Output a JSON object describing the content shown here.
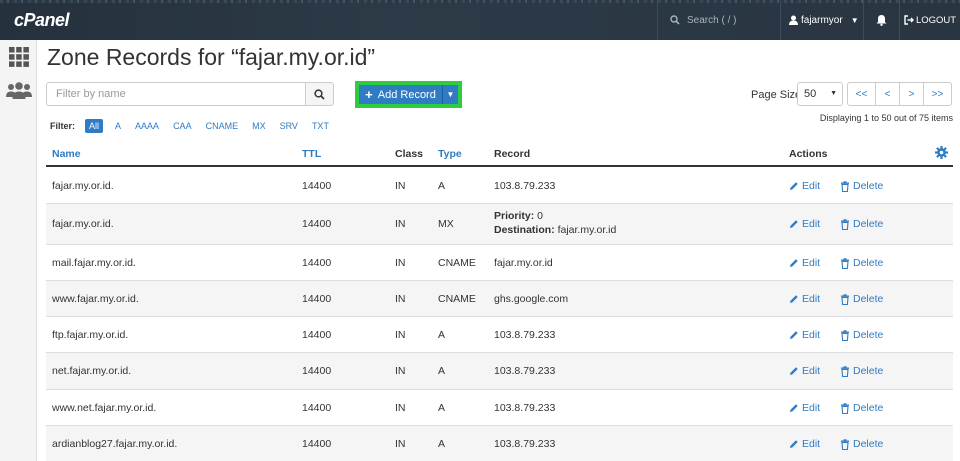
{
  "header": {
    "logo": "cPanel",
    "search_placeholder": "Search ( / )",
    "username": "fajarmyor",
    "logout": "LOGOUT"
  },
  "page": {
    "title": "Zone Records for “fajar.my.or.id”",
    "filter_placeholder": "Filter by name",
    "add_record": "Add Record",
    "page_size_label": "Page Size",
    "page_size_value": "50",
    "pager": [
      "<<",
      "<",
      ">",
      ">>"
    ],
    "displaying": "Displaying 1 to 50 out of 75 items",
    "filter_label": "Filter:",
    "filter_types": [
      "All",
      "A",
      "AAAA",
      "CAA",
      "CNAME",
      "MX",
      "SRV",
      "TXT"
    ]
  },
  "table": {
    "columns": {
      "name": "Name",
      "ttl": "TTL",
      "class": "Class",
      "type": "Type",
      "record": "Record",
      "actions": "Actions"
    },
    "edit_label": "Edit",
    "delete_label": "Delete",
    "rows": [
      {
        "name": "fajar.my.or.id.",
        "ttl": "14400",
        "class": "IN",
        "type": "A",
        "record": "103.8.79.233"
      },
      {
        "name": "fajar.my.or.id.",
        "ttl": "14400",
        "class": "IN",
        "type": "MX",
        "priority_label": "Priority:",
        "priority": " 0",
        "destination_label": "Destination:",
        "destination": " fajar.my.or.id"
      },
      {
        "name": "mail.fajar.my.or.id.",
        "ttl": "14400",
        "class": "IN",
        "type": "CNAME",
        "record": "fajar.my.or.id"
      },
      {
        "name": "www.fajar.my.or.id.",
        "ttl": "14400",
        "class": "IN",
        "type": "CNAME",
        "record": "ghs.google.com"
      },
      {
        "name": "ftp.fajar.my.or.id.",
        "ttl": "14400",
        "class": "IN",
        "type": "A",
        "record": "103.8.79.233"
      },
      {
        "name": "net.fajar.my.or.id.",
        "ttl": "14400",
        "class": "IN",
        "type": "A",
        "record": "103.8.79.233"
      },
      {
        "name": "www.net.fajar.my.or.id.",
        "ttl": "14400",
        "class": "IN",
        "type": "A",
        "record": "103.8.79.233"
      },
      {
        "name": "ardianblog27.fajar.my.or.id.",
        "ttl": "14400",
        "class": "IN",
        "type": "A",
        "record": "103.8.79.233"
      }
    ]
  },
  "colors": {
    "accent": "#2f7bc4",
    "highlight": "#2ecc40",
    "topbar": "#2a3642"
  },
  "icons": [
    "grid-icon",
    "users-icon",
    "search-icon",
    "user-icon",
    "bell-icon",
    "logout-icon",
    "plus-icon",
    "gear-icon",
    "pencil-icon",
    "trash-icon"
  ]
}
